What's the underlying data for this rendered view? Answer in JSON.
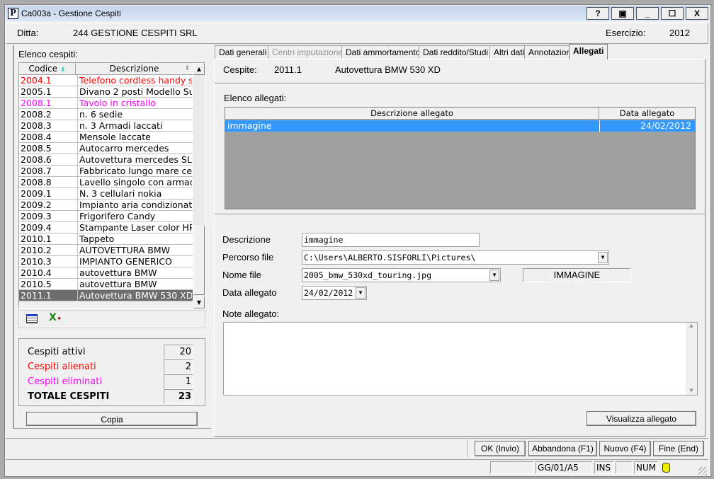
{
  "window": {
    "title": "Ca003a - Gestione Cespiti",
    "app_icon": "P",
    "buttons": [
      "help",
      "restore-small",
      "minimize",
      "maximize",
      "close"
    ]
  },
  "header": {
    "ditta_label": "Ditta:",
    "ditta_value": "244  GESTIONE CESPITI SRL",
    "esercizio_label": "Esercizio:",
    "esercizio_value": "2012"
  },
  "left": {
    "list_title": "Elenco cespiti:",
    "columns": [
      "Codice",
      "Descrizione"
    ],
    "rows": [
      {
        "code": "2004.1",
        "desc": "Telefono cordless handy s",
        "color": "#ff0000"
      },
      {
        "code": "2005.1",
        "desc": "Divano 2 posti Modello Su",
        "color": "#000000"
      },
      {
        "code": "2008.1",
        "desc": "Tavolo in cristallo",
        "color": "#ff00ff"
      },
      {
        "code": "2008.2",
        "desc": "n. 6 sedie",
        "color": "#000000"
      },
      {
        "code": "2008.3",
        "desc": "n. 3 Armadi laccati",
        "color": "#000000"
      },
      {
        "code": "2008.4",
        "desc": "Mensole laccate",
        "color": "#000000"
      },
      {
        "code": "2008.5",
        "desc": "Autocarro mercedes",
        "color": "#000000"
      },
      {
        "code": "2008.6",
        "desc": "Autovettura mercedes SL",
        "color": "#000000"
      },
      {
        "code": "2008.7",
        "desc": "Fabbricato lungo mare ce",
        "color": "#000000"
      },
      {
        "code": "2008.8",
        "desc": "Lavello singolo con armad",
        "color": "#000000"
      },
      {
        "code": "2009.1",
        "desc": "N. 3 cellulari nokia",
        "color": "#000000"
      },
      {
        "code": "2009.2",
        "desc": "Impianto aria condizionat",
        "color": "#000000"
      },
      {
        "code": "2009.3",
        "desc": "Frigorifero Candy",
        "color": "#000000"
      },
      {
        "code": "2009.4",
        "desc": "Stampante Laser color HP",
        "color": "#000000"
      },
      {
        "code": "2010.1",
        "desc": "Tappeto",
        "color": "#000000"
      },
      {
        "code": "2010.2",
        "desc": "AUTOVETTURA BMW",
        "color": "#000000"
      },
      {
        "code": "2010.3",
        "desc": "IMPIANTO GENERICO",
        "color": "#000000"
      },
      {
        "code": "2010.4",
        "desc": "autovettura BMW",
        "color": "#000000"
      },
      {
        "code": "2010.5",
        "desc": "autovettura BMW",
        "color": "#000000"
      },
      {
        "code": "2011.1",
        "desc": "Autovettura BMW 530 XD",
        "color": "#ffffff",
        "selected": true
      }
    ],
    "toolbar_icons": [
      "grid-view-icon",
      "excel-export-icon"
    ],
    "totals": [
      {
        "label": "Cespiti attivi",
        "value": "20",
        "color": "#000000"
      },
      {
        "label": "Cespiti alienati",
        "value": "2",
        "color": "#ff0000"
      },
      {
        "label": "Cespiti eliminati",
        "value": "1",
        "color": "#ff00ff"
      },
      {
        "label": "TOTALE CESPITI",
        "value": "23",
        "color": "#000000",
        "bold": true
      }
    ],
    "copy_button": "Copia"
  },
  "tabs": [
    {
      "label": "Dati generali"
    },
    {
      "label": "Centri imputazione",
      "disabled": true
    },
    {
      "label": "Dati ammortamento"
    },
    {
      "label": "Dati reddito/Studi"
    },
    {
      "label": "Altri dati"
    },
    {
      "label": "Annotazioni"
    },
    {
      "label": "Allegati",
      "active": true
    }
  ],
  "allegati": {
    "cespite_label": "Cespite:",
    "cespite_code": "2011.1",
    "cespite_desc": "Autovettura BMW 530 XD",
    "list_title": "Elenco allegati:",
    "columns": [
      "Descrizione allegato",
      "Data allegato"
    ],
    "rows": [
      {
        "desc": "immagine",
        "date": "24/02/2012",
        "selected": true
      }
    ],
    "form": {
      "descrizione_label": "Descrizione",
      "descrizione_value": "immagine",
      "percorso_label": "Percorso file",
      "percorso_value": "C:\\Users\\ALBERTO.SISFORLI\\Pictures\\",
      "nome_label": "Nome file",
      "nome_value": "2005_bmw_530xd_touring.jpg",
      "tipo_value": "IMMAGINE",
      "data_label": "Data allegato",
      "data_value": "24/02/2012",
      "note_label": "Note allegato:",
      "note_value": ""
    },
    "view_button": "Visualizza allegato"
  },
  "footer": {
    "buttons": [
      "OK (Invio)",
      "Abbandona (F1)",
      "Nuovo (F4)",
      "Fine (End)"
    ]
  },
  "status": {
    "field1": "",
    "mode": "GG/01/A5",
    "ins": "INS",
    "field4": "",
    "num": "NUM"
  },
  "colors": {
    "selection": "#3399ff",
    "list_selected": "#6d6d6d",
    "grid_bg": "#a0a0a0"
  }
}
